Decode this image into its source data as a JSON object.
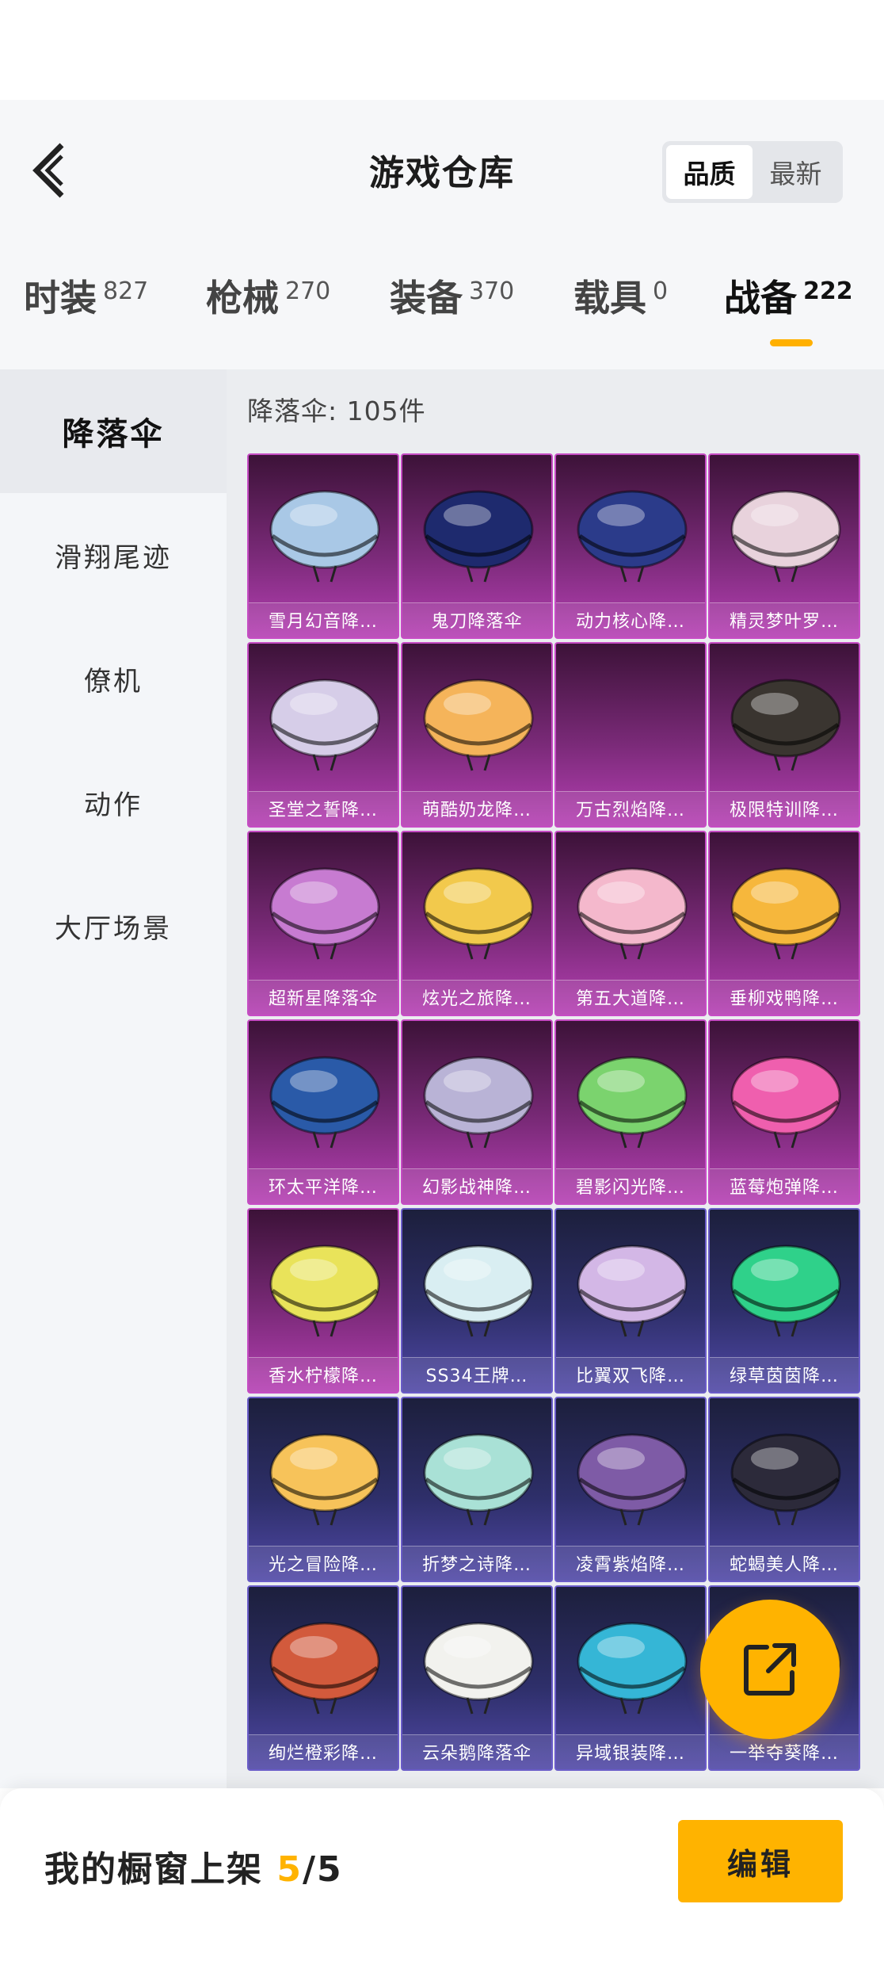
{
  "header": {
    "title": "游戏仓库",
    "sort_options": [
      "品质",
      "最新"
    ],
    "sort_selected": "品质"
  },
  "tabs": [
    {
      "label": "时装",
      "count": "827"
    },
    {
      "label": "枪械",
      "count": "270"
    },
    {
      "label": "装备",
      "count": "370"
    },
    {
      "label": "载具",
      "count": "0"
    },
    {
      "label": "战备",
      "count": "222"
    }
  ],
  "active_tab": "战备",
  "sidebar": {
    "items": [
      "降落伞",
      "滑翔尾迹",
      "僚机",
      "动作",
      "大厅场景"
    ],
    "active": "降落伞"
  },
  "content": {
    "count_label": "降落伞: 105件",
    "items": [
      {
        "name": "雪月幻音降…",
        "tier": "purple",
        "color": "#a9c8e6"
      },
      {
        "name": "鬼刀降落伞",
        "tier": "purple",
        "color": "#1e2a6e"
      },
      {
        "name": "动力核心降…",
        "tier": "purple",
        "color": "#2b3b8a"
      },
      {
        "name": "精灵梦叶罗…",
        "tier": "purple",
        "color": "#e8d2dc"
      },
      {
        "name": "圣堂之誓降…",
        "tier": "purple",
        "color": "#d6cde8"
      },
      {
        "name": "萌酷奶龙降…",
        "tier": "purple",
        "color": "#f5b45a"
      },
      {
        "name": "万古烈焰降…",
        "tier": "purple",
        "color": ""
      },
      {
        "name": "极限特训降…",
        "tier": "purple",
        "color": "#3a3530"
      },
      {
        "name": "超新星降落伞",
        "tier": "purple",
        "color": "#c77bd1"
      },
      {
        "name": "炫光之旅降…",
        "tier": "purple",
        "color": "#f2c94c"
      },
      {
        "name": "第五大道降…",
        "tier": "purple",
        "color": "#f4b8cc"
      },
      {
        "name": "垂柳戏鸭降…",
        "tier": "purple",
        "color": "#f6b73c"
      },
      {
        "name": "环太平洋降…",
        "tier": "purple",
        "color": "#2a5aa8"
      },
      {
        "name": "幻影战神降…",
        "tier": "purple",
        "color": "#b9b3d6"
      },
      {
        "name": "碧影闪光降…",
        "tier": "purple",
        "color": "#7bd36e"
      },
      {
        "name": "蓝莓炮弹降…",
        "tier": "purple",
        "color": "#ef5fae"
      },
      {
        "name": "香水柠檬降…",
        "tier": "purple",
        "color": "#e9e35a"
      },
      {
        "name": "SS34王牌…",
        "tier": "blue",
        "color": "#d9eef2"
      },
      {
        "name": "比翼双飞降…",
        "tier": "blue",
        "color": "#d3b7e6"
      },
      {
        "name": "绿草茵茵降…",
        "tier": "blue",
        "color": "#2fd18a"
      },
      {
        "name": "光之冒险降…",
        "tier": "blue",
        "color": "#f7c35a"
      },
      {
        "name": "折梦之诗降…",
        "tier": "blue",
        "color": "#a9e1d6"
      },
      {
        "name": "凌霄紫焰降…",
        "tier": "blue",
        "color": "#7e5ba6"
      },
      {
        "name": "蛇蝎美人降…",
        "tier": "blue",
        "color": "#2c2a3a"
      },
      {
        "name": "绚烂橙彩降…",
        "tier": "blue",
        "color": "#d25a3c"
      },
      {
        "name": "云朵鹅降落伞",
        "tier": "blue",
        "color": "#f2f2ee"
      },
      {
        "name": "异域银装降…",
        "tier": "blue",
        "color": "#35b6d6"
      },
      {
        "name": "一举夺葵降…",
        "tier": "blue",
        "color": "#f0c040"
      }
    ]
  },
  "fab": {
    "icon": "share-icon"
  },
  "bottom": {
    "shelf_label": "我的橱窗上架",
    "shelf_current": "5",
    "shelf_total": "/5",
    "edit_label": "编辑"
  }
}
